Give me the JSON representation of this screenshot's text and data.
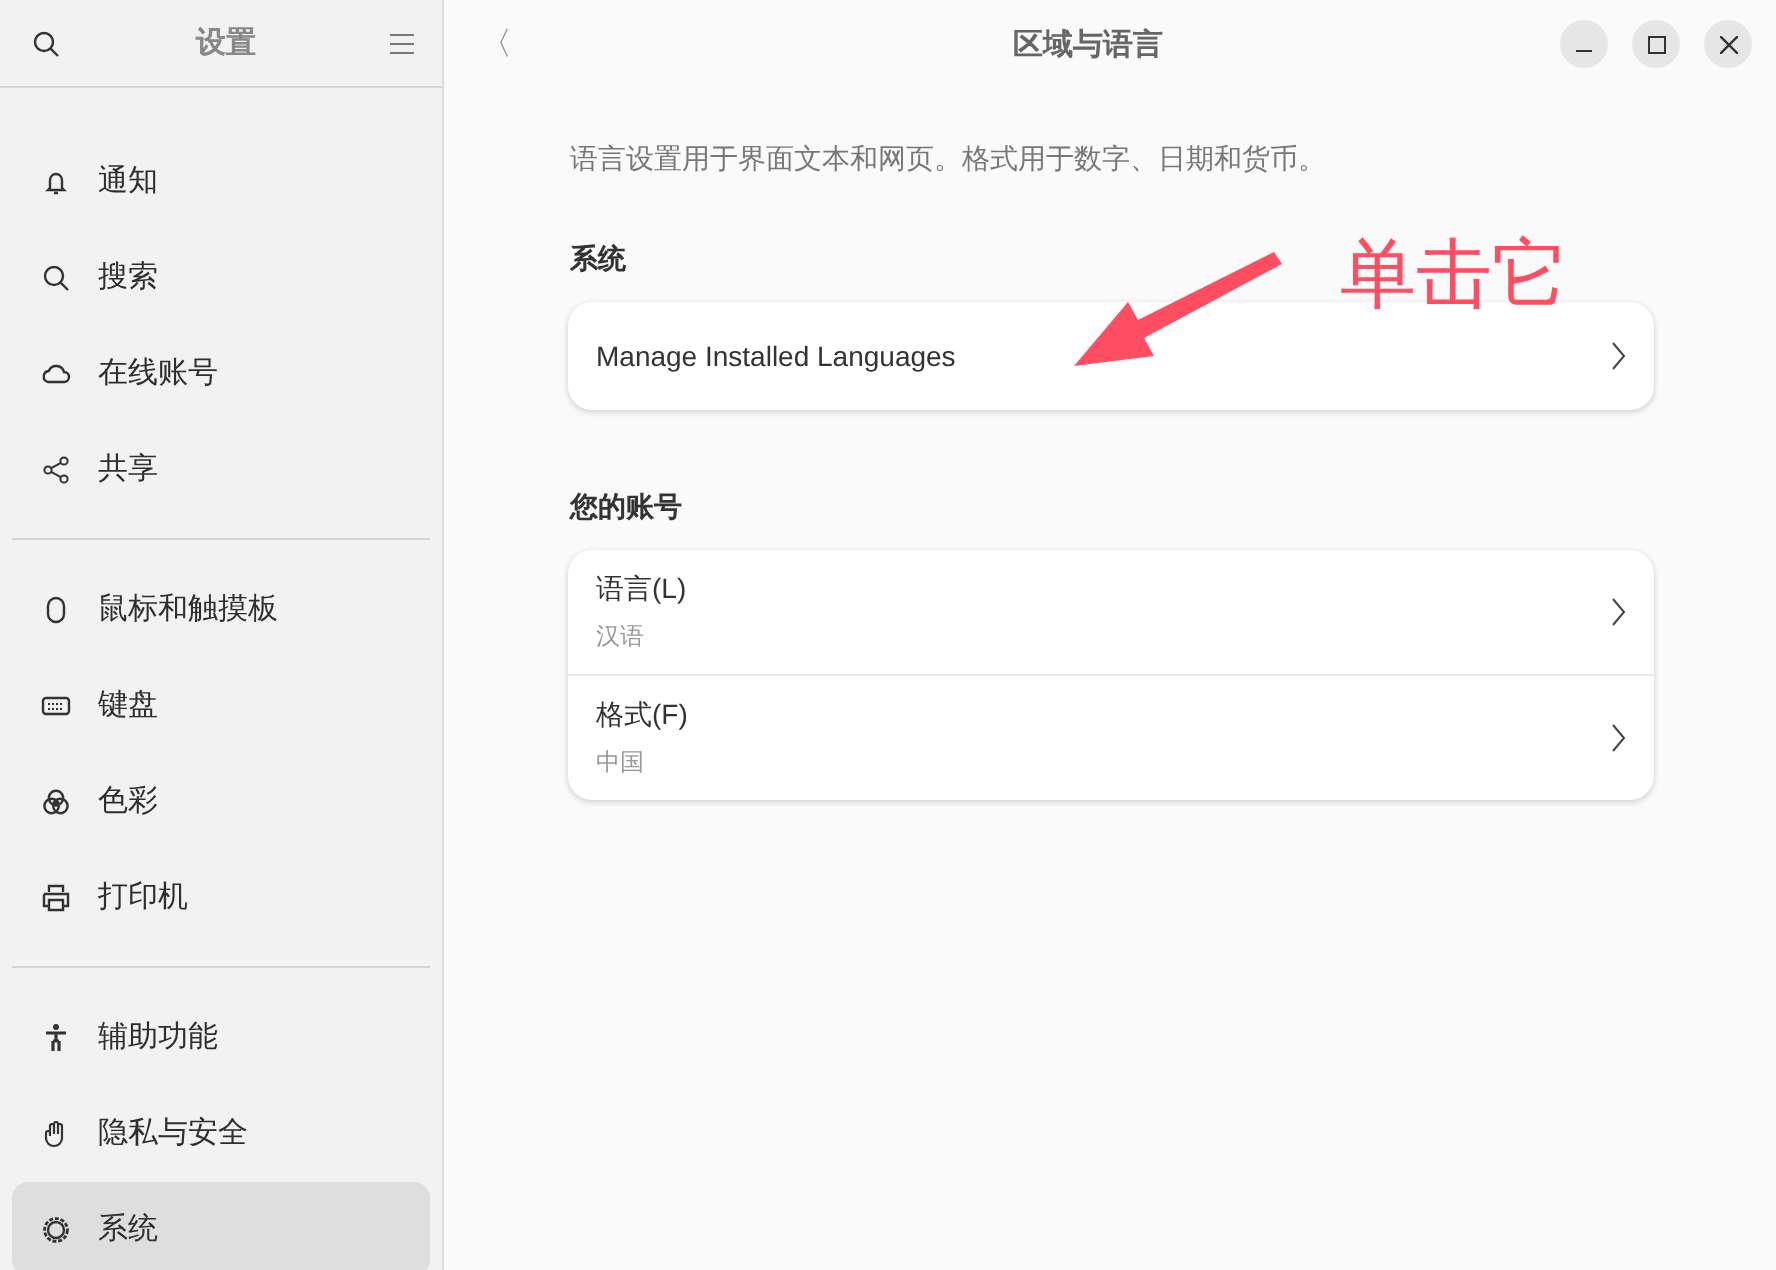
{
  "sidebar": {
    "title": "设置",
    "groups": [
      [
        {
          "kind": "notifications",
          "label": "通知",
          "selected": false
        },
        {
          "kind": "search",
          "label": "搜索",
          "selected": false
        },
        {
          "kind": "cloud",
          "label": "在线账号",
          "selected": false
        },
        {
          "kind": "share",
          "label": "共享",
          "selected": false
        }
      ],
      [
        {
          "kind": "mouse",
          "label": "鼠标和触摸板",
          "selected": false
        },
        {
          "kind": "keyboard",
          "label": "键盘",
          "selected": false
        },
        {
          "kind": "color",
          "label": "色彩",
          "selected": false
        },
        {
          "kind": "printer",
          "label": "打印机",
          "selected": false
        }
      ],
      [
        {
          "kind": "accessibility",
          "label": "辅助功能",
          "selected": false
        },
        {
          "kind": "privacy",
          "label": "隐私与安全",
          "selected": false
        },
        {
          "kind": "system",
          "label": "系统",
          "selected": true
        }
      ]
    ]
  },
  "page": {
    "title": "区域与语言",
    "back": "〈",
    "description": "语言设置用于界面文本和网页。格式用于数字、日期和货币。",
    "sections": [
      {
        "heading": "系统",
        "rows": [
          {
            "label": "Manage Installed Languages"
          }
        ]
      },
      {
        "heading": "您的账号",
        "rows": [
          {
            "label": "语言(L)",
            "value": "汉语"
          },
          {
            "label": "格式(F)",
            "value": "中国"
          }
        ]
      }
    ]
  },
  "annotation": {
    "text": "单击它"
  }
}
